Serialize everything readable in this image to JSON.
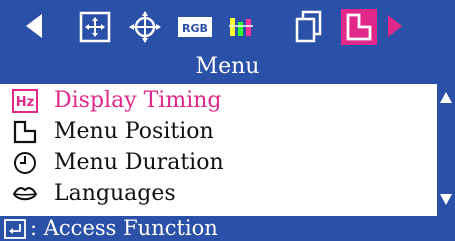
{
  "menu": {
    "title": "Menu"
  },
  "toolbar": {
    "icons": [
      {
        "name": "position-move-icon"
      },
      {
        "name": "geometry-icon"
      },
      {
        "name": "rgb-icon",
        "text": "RGB"
      },
      {
        "name": "color-bars-icon"
      },
      {
        "name": "copy-windows-icon"
      },
      {
        "name": "menu-position-icon"
      }
    ]
  },
  "items": [
    {
      "label": "Display Timing",
      "icon": "hz-icon",
      "icon_text": "Hz",
      "selected": true
    },
    {
      "label": "Menu Position",
      "icon": "menu-position-icon",
      "selected": false
    },
    {
      "label": "Menu Duration",
      "icon": "clock-icon",
      "selected": false
    },
    {
      "label": "Languages",
      "icon": "lips-icon",
      "selected": false
    }
  ],
  "footer": {
    "label": ": Access Function"
  },
  "colors": {
    "panel_blue": "#2b50a8",
    "accent_magenta": "#e0288a",
    "white": "#ffffff"
  }
}
